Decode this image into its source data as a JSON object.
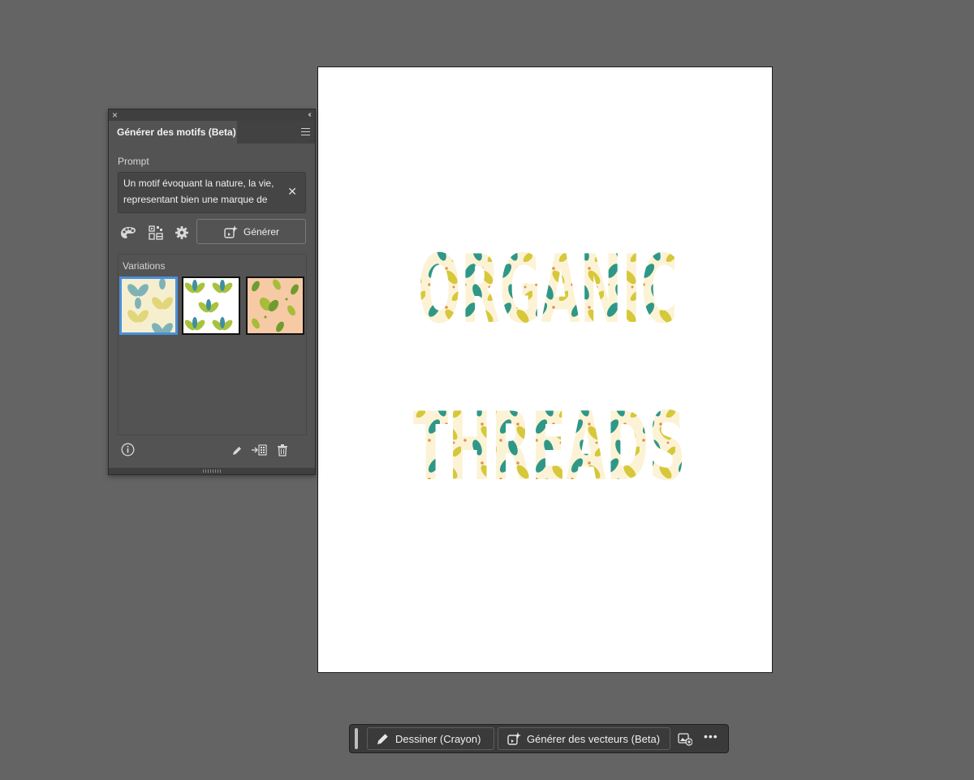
{
  "artboard": {
    "title_line1": "ORGANIC",
    "title_line2": "THREADS"
  },
  "panel": {
    "close_glyph": "×",
    "collapse_glyph": "‹‹",
    "tab_title": "Générer des motifs (Beta)",
    "prompt_label": "Prompt",
    "prompt_text_line1": "Un motif évoquant la nature, la vie,",
    "prompt_text_line2": "representant bien une marque de",
    "clear_glyph": "✕",
    "generate_label": "Générer",
    "variations_label": "Variations",
    "icons": [
      "palette-icon",
      "pattern-grid-icon",
      "gear-icon",
      "generate-icon",
      "info-icon",
      "pencil-icon",
      "export-swatch-icon",
      "trash-icon"
    ]
  },
  "variations": [
    {
      "bg": "#f6efcf",
      "leaf1": "#e2d67a",
      "leaf2": "#7fb2b6",
      "selected": true
    },
    {
      "bg": "#ffffff",
      "leaf1": "#a9c23d",
      "leaf2": "#3f8fa2",
      "selected": false
    },
    {
      "bg": "#f7caa6",
      "leaf1": "#a9bc3a",
      "leaf2": "#6f9c2e",
      "selected": false
    }
  ],
  "taskbar": {
    "draw_label": "Dessiner (Crayon)",
    "vectors_label": "Générer des vecteurs (Beta)",
    "more_glyph": "•••"
  },
  "colors": {
    "canvas": "#646464",
    "panel_bg": "#535353",
    "selection_blue": "#4a90d9",
    "pattern_cream": "#fcf3d6",
    "pattern_teal": "#2f9787",
    "pattern_yellow": "#d6c83a"
  }
}
